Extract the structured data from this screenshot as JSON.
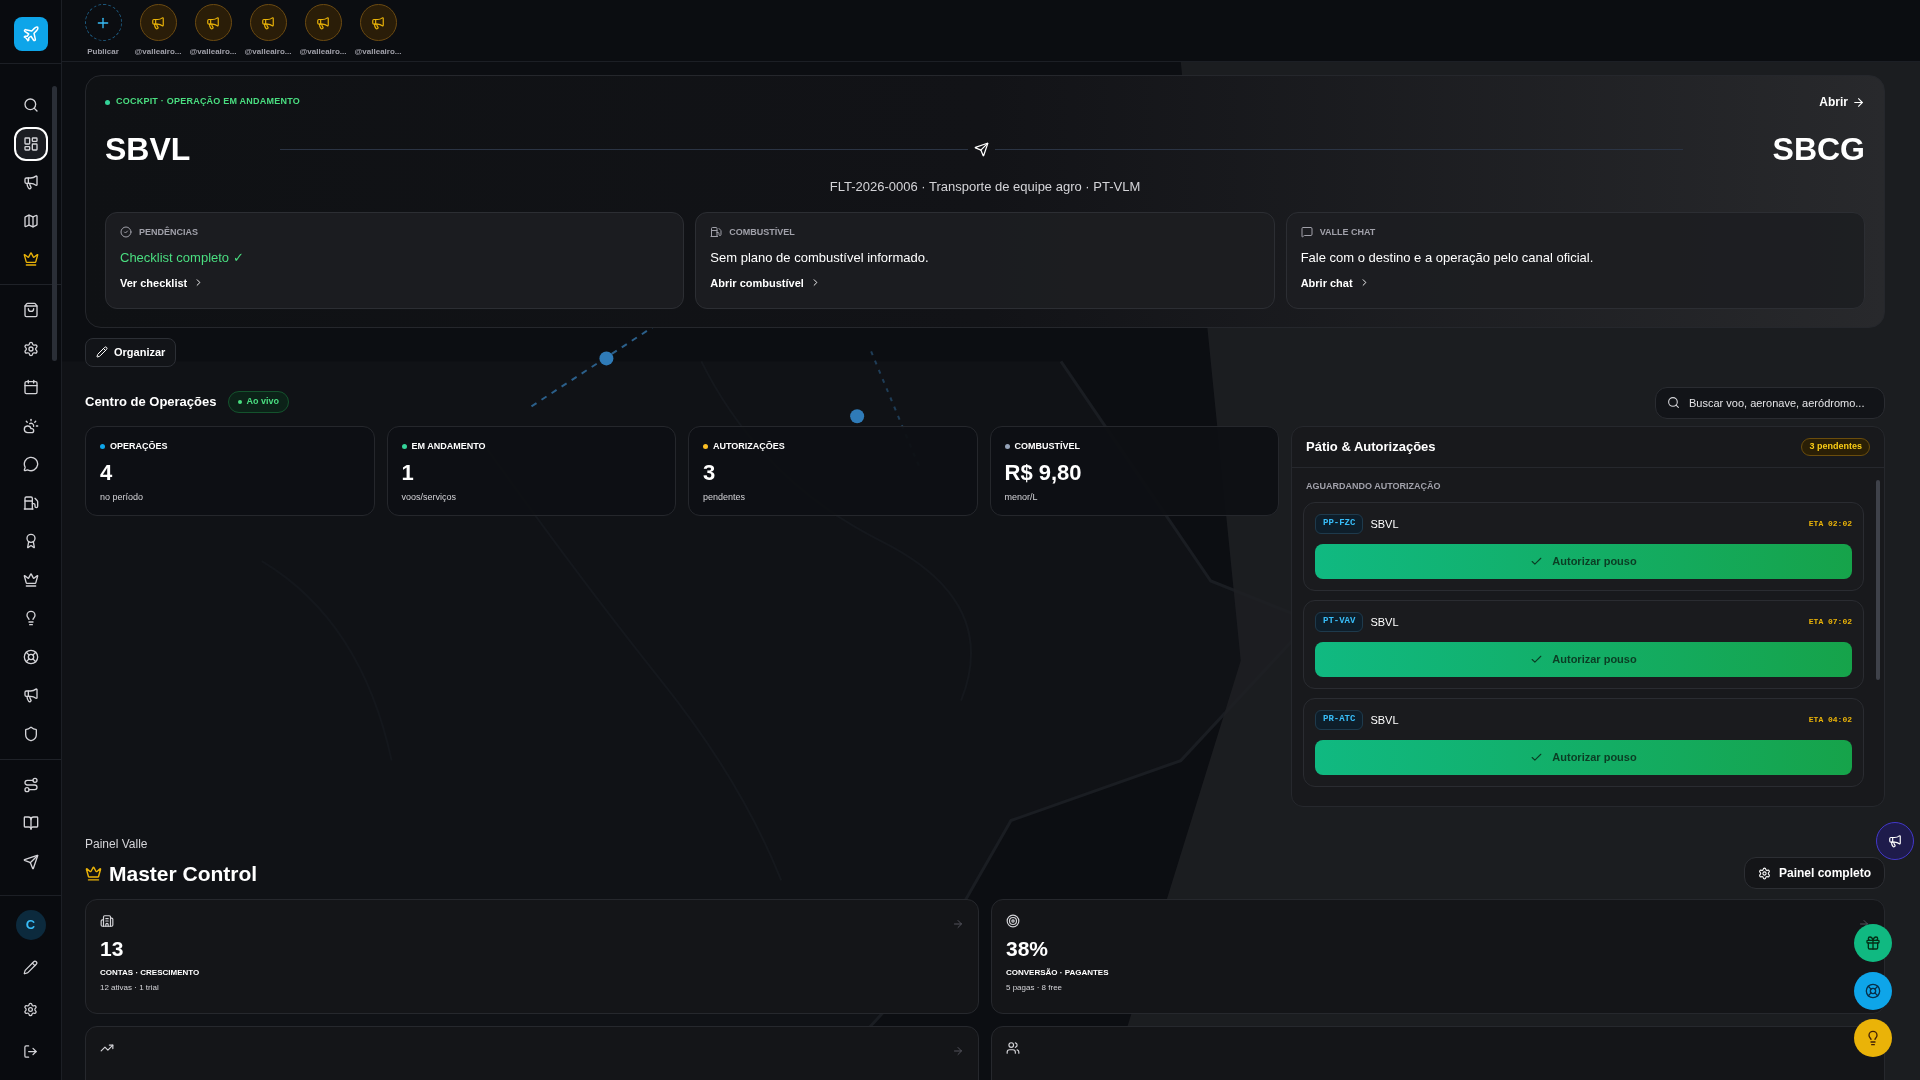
{
  "sidebar": {
    "groups": [
      [
        {
          "selected": false,
          "highlighted": false
        },
        {
          "selected": true,
          "highlighted": false
        },
        {
          "selected": false,
          "highlighted": false
        },
        {
          "selected": false,
          "highlighted": false
        },
        {
          "selected": false,
          "highlighted": true
        }
      ],
      [
        {
          "selected": false,
          "highlighted": false
        },
        {
          "selected": false,
          "highlighted": false
        },
        {
          "selected": false,
          "highlighted": false
        },
        {
          "selected": false,
          "highlighted": false
        },
        {
          "selected": false,
          "highlighted": false
        },
        {
          "selected": false,
          "highlighted": false
        },
        {
          "selected": false,
          "highlighted": false
        },
        {
          "selected": false,
          "highlighted": false
        },
        {
          "selected": false,
          "highlighted": false
        },
        {
          "selected": false,
          "highlighted": false
        },
        {
          "selected": false,
          "highlighted": false
        },
        {
          "selected": false,
          "highlighted": false
        }
      ],
      [
        {
          "selected": false,
          "highlighted": false
        },
        {
          "selected": false,
          "highlighted": false
        },
        {
          "selected": false,
          "highlighted": false
        }
      ]
    ],
    "user": {
      "initial": "C"
    }
  },
  "stories": {
    "publish": "Publicar",
    "items": [
      "@valleairo...",
      "@valleairo...",
      "@valleairo...",
      "@valleairo...",
      "@valleairo..."
    ]
  },
  "cockpit": {
    "status": "COCKPIT · OPERAÇÃO EM ANDAMENTO",
    "open": "Abrir",
    "origin": "SBVL",
    "destination": "SBCG",
    "flight": "FLT-2026-0006 · Transporte de equipe agro · PT-VLM",
    "cards": [
      {
        "title": "PENDÊNCIAS",
        "text": "Checklist completo ✓",
        "done": true,
        "link": "Ver checklist"
      },
      {
        "title": "COMBUSTÍVEL",
        "text": "Sem plano de combustível informado.",
        "done": false,
        "link": "Abrir combustível"
      },
      {
        "title": "VALLE CHAT",
        "text": "Fale com o destino e a operação pelo canal oficial.",
        "done": false,
        "link": "Abrir chat"
      }
    ]
  },
  "organize": "Organizar",
  "operations": {
    "title": "Centro de Operações",
    "live": "Ao vivo",
    "search": {
      "placeholder": "Buscar voo, aeronave, aeródromo..."
    },
    "stats": [
      {
        "label": "OPERAÇÕES",
        "value": "4",
        "caption": "no período",
        "color": "#0ea5e9"
      },
      {
        "label": "EM ANDAMENTO",
        "value": "1",
        "caption": "voos/serviços",
        "color": "#34d399"
      },
      {
        "label": "AUTORIZAÇÕES",
        "value": "3",
        "caption": "pendentes",
        "color": "#fbbf24"
      },
      {
        "label": "COMBUSTÍVEL",
        "value": "R$ 9,80",
        "caption": "menor/L",
        "color": "#94a3b8"
      }
    ]
  },
  "yard": {
    "title": "Pátio & Autorizações",
    "badge": "3 pendentes",
    "section": "AGUARDANDO AUTORIZAÇÃO",
    "items": [
      {
        "tail": "PP-FZC",
        "airport": "SBVL",
        "eta": "ETA 02:02",
        "action": "Autorizar pouso"
      },
      {
        "tail": "PT-VAV",
        "airport": "SBVL",
        "eta": "ETA 07:02",
        "action": "Autorizar pouso"
      },
      {
        "tail": "PR-ATC",
        "airport": "SBVL",
        "eta": "ETA 04:02",
        "action": "Autorizar pouso"
      }
    ]
  },
  "master": {
    "eyebrow": "Painel Valle",
    "title": "Master Control",
    "full": "Painel completo",
    "cards": [
      {
        "value": "13",
        "label": "CONTAS · CRESCIMENTO",
        "detail": "12 ativas · 1 trial"
      },
      {
        "value": "38%",
        "label": "CONVERSÃO · PAGANTES",
        "detail": "5 pagas · 8 free"
      }
    ]
  }
}
